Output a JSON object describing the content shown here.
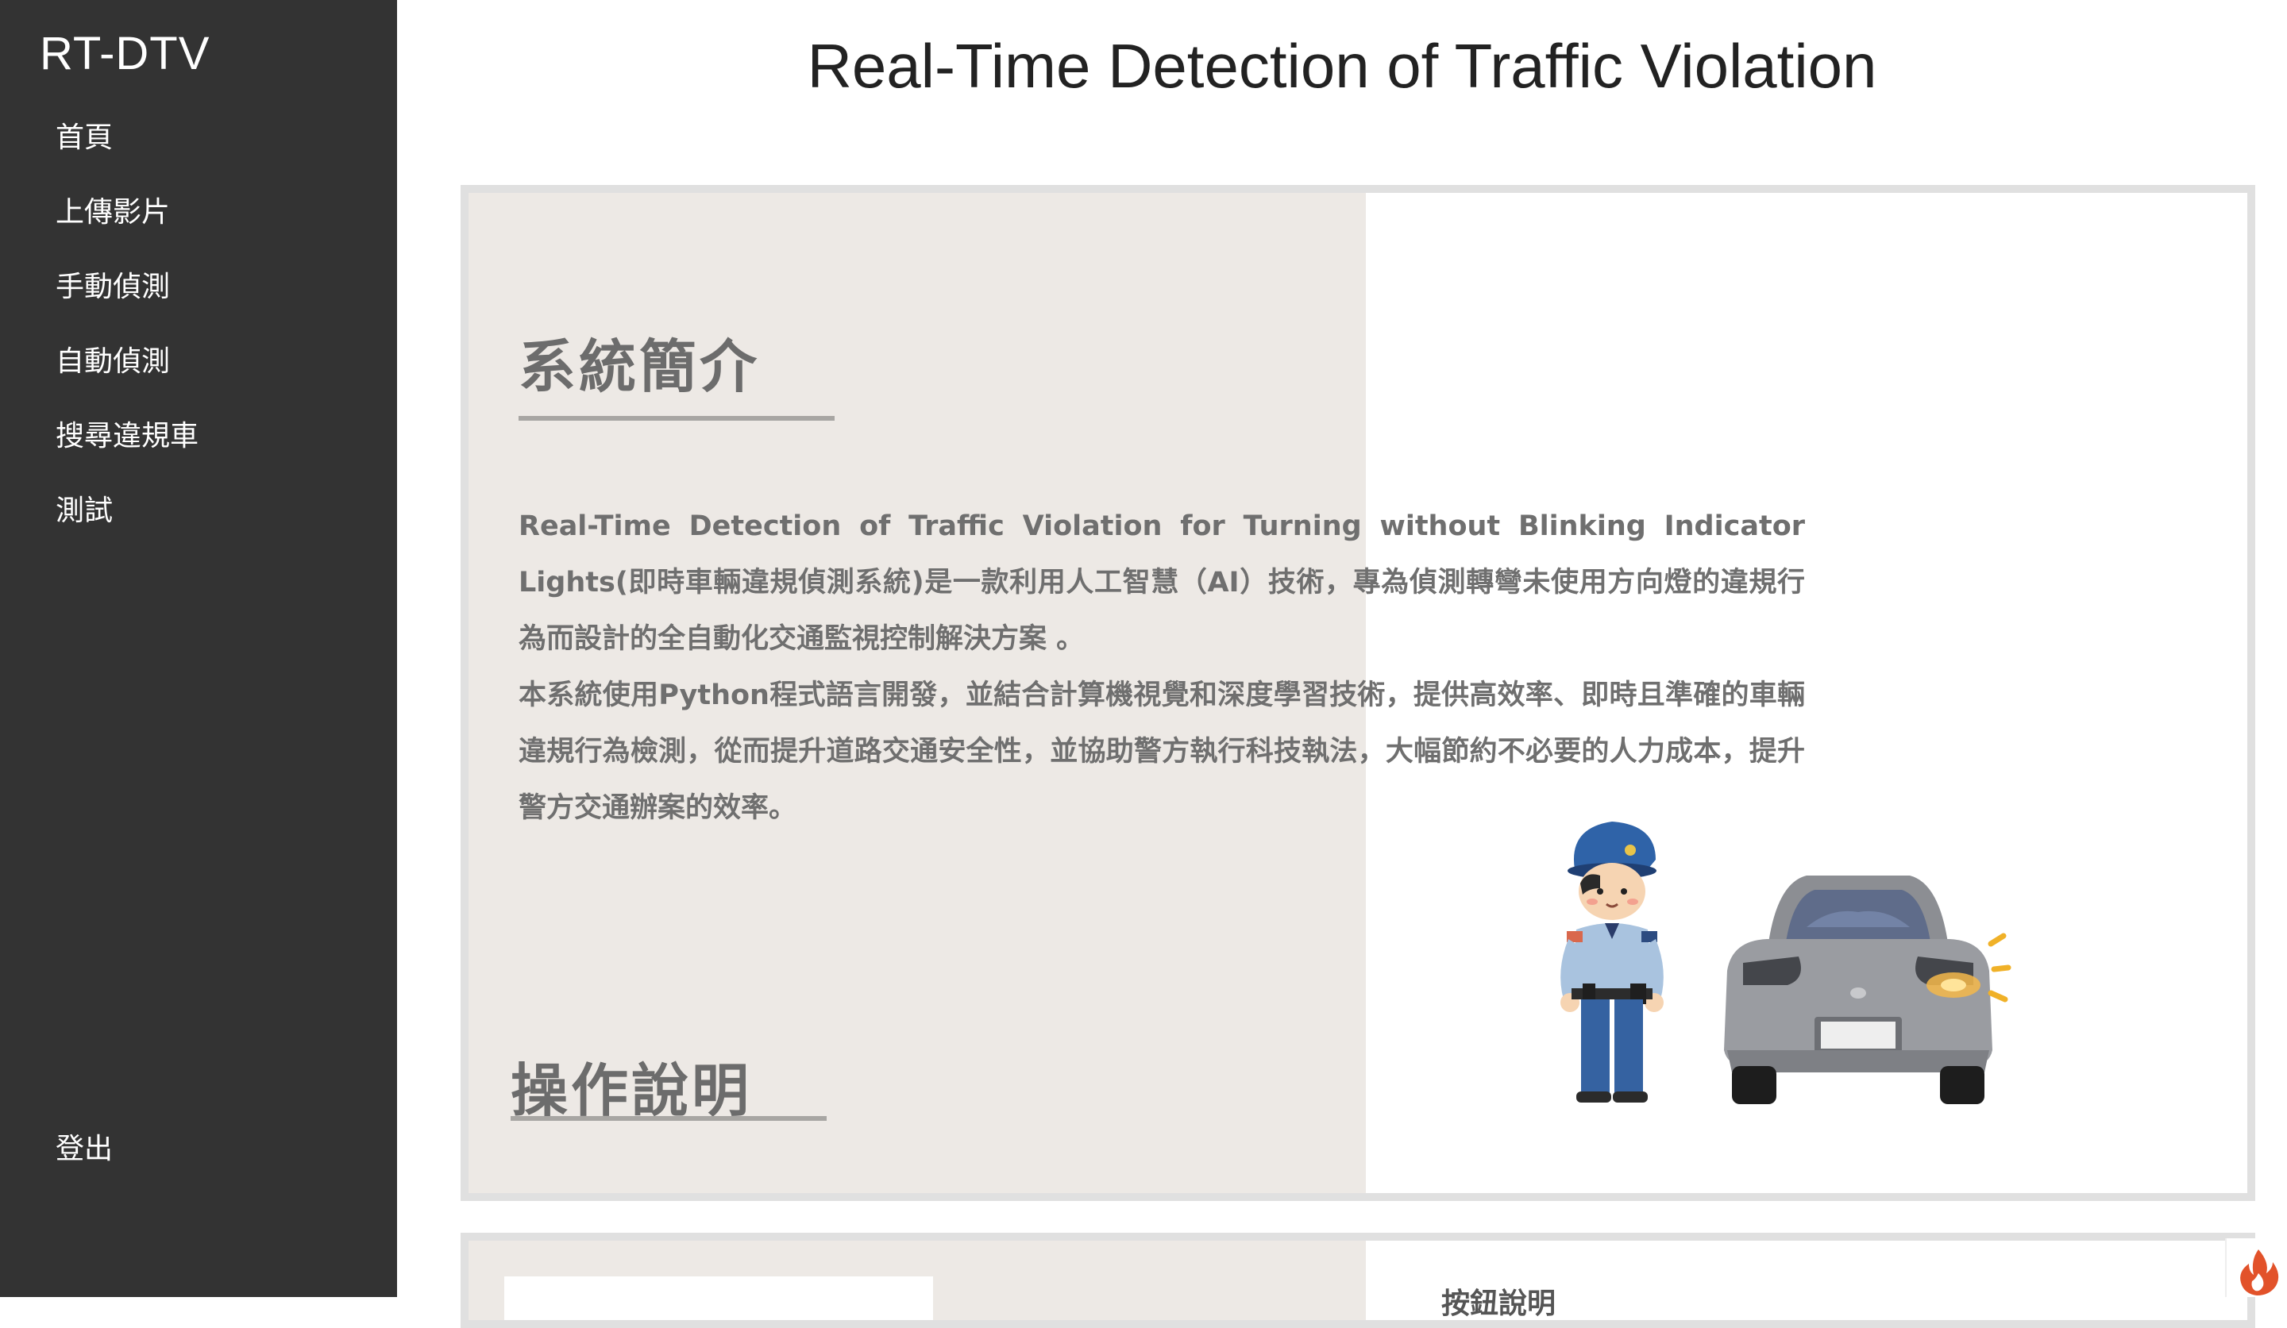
{
  "sidebar": {
    "brand": "RT-DTV",
    "items": [
      {
        "label": "首頁"
      },
      {
        "label": "上傳影片"
      },
      {
        "label": "手動偵測"
      },
      {
        "label": "自動偵測"
      },
      {
        "label": "搜尋違規車"
      },
      {
        "label": "測試"
      }
    ],
    "logout": "登出"
  },
  "header": {
    "title": "Real-Time Detection of Traffic Violation"
  },
  "intro_card": {
    "heading": "系統簡介",
    "paragraphs": [
      "Real-Time Detection of Traffic Violation for Turning without Blinking Indicator Lights(即時車輛違規偵測系統)是一款利用人工智慧（AI）技術，專為偵測轉彎未使用方向燈的違規行為而設計的全自動化交通監視控制解決方案 。",
      "本系統使用Python程式語言開發，並結合計算機視覺和深度學習技術，提供高效率、即時且準確的車輛違規行為檢測，從而提升道路交通安全性，並協助警方執行科技執法，大幅節約不必要的人力成本，提升警方交通辦案的效率。"
    ],
    "second_heading": "操作說明"
  },
  "next_card": {
    "label": "按鈕說明"
  },
  "colors": {
    "sidebar": "#333333",
    "panel_beige": "#ede9e5",
    "card_border": "#e0e0e0",
    "text_gray": "#6f6f6f"
  },
  "icons": [
    "police-officer-illustration",
    "car-rear-blinker-illustration",
    "fire-icon"
  ]
}
